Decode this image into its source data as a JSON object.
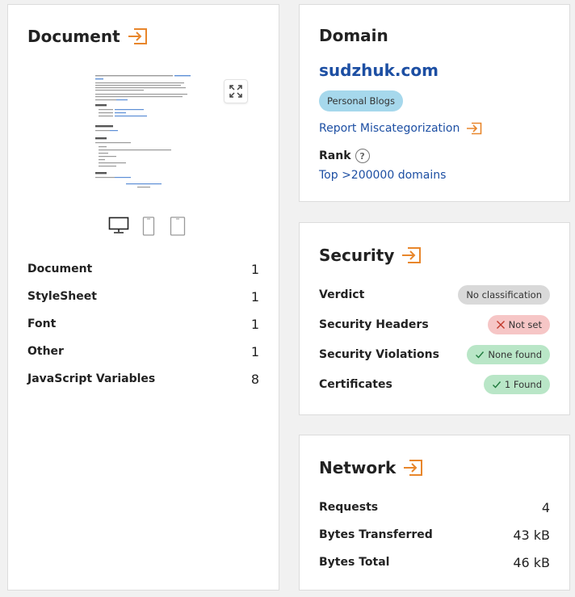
{
  "document_card": {
    "title": "Document",
    "stats": [
      {
        "label": "Document",
        "value": "1"
      },
      {
        "label": "StyleSheet",
        "value": "1"
      },
      {
        "label": "Font",
        "value": "1"
      },
      {
        "label": "Other",
        "value": "1"
      },
      {
        "label": "JavaScript Variables",
        "value": "8"
      }
    ],
    "devices": [
      "desktop-icon",
      "mobile-icon",
      "tablet-icon"
    ]
  },
  "domain_card": {
    "title": "Domain",
    "domain": "sudzhuk.com",
    "category": "Personal Blogs",
    "report_label": "Report Miscategorization",
    "rank_label": "Rank",
    "rank_value": "Top >200000 domains"
  },
  "security_card": {
    "title": "Security",
    "rows": [
      {
        "label": "Verdict",
        "value": "No classification",
        "status": "neutral"
      },
      {
        "label": "Security Headers",
        "value": "Not set",
        "status": "bad"
      },
      {
        "label": "Security Violations",
        "value": "None found",
        "status": "good"
      },
      {
        "label": "Certificates",
        "value": "1 Found",
        "status": "good"
      }
    ]
  },
  "network_card": {
    "title": "Network",
    "stats": [
      {
        "label": "Requests",
        "value": "4"
      },
      {
        "label": "Bytes Transferred",
        "value": "43 kB"
      },
      {
        "label": "Bytes Total",
        "value": "46 kB"
      }
    ]
  },
  "colors": {
    "accent_orange": "#e8862b",
    "link_blue": "#1d4fa3",
    "category_badge": "#a6d8ec",
    "neutral_pill": "#d9d9d9",
    "bad_pill": "#f6c6c6",
    "good_pill": "#b9e6c7"
  }
}
